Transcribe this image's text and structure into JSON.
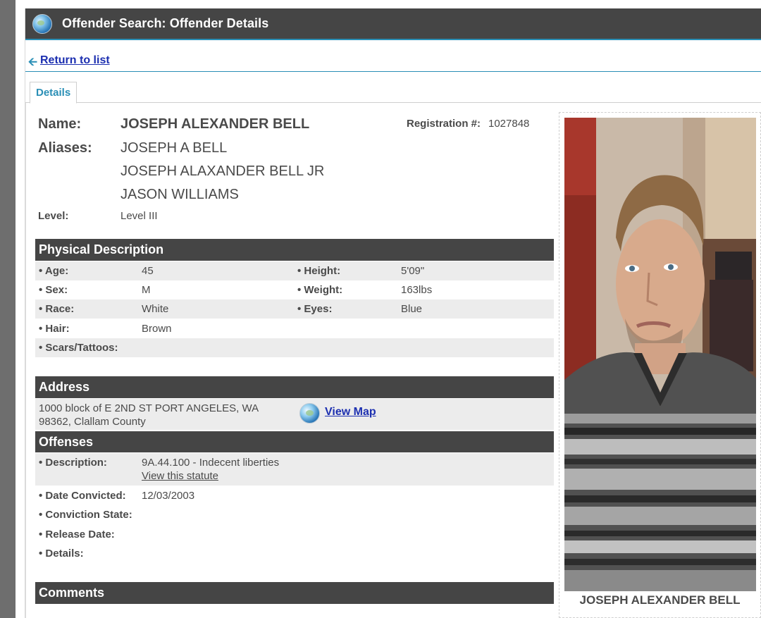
{
  "window": {
    "title": "Offender Search: Offender Details"
  },
  "nav": {
    "return_label": "Return to list"
  },
  "tabs": [
    {
      "label": "Details"
    }
  ],
  "offender": {
    "name_label": "Name:",
    "name": "JOSEPH ALEXANDER BELL",
    "aliases_label": "Aliases:",
    "aliases": [
      "JOSEPH A BELL",
      "JOSEPH ALAXANDER BELL JR",
      "JASON WILLIAMS"
    ],
    "registration_label": "Registration #:",
    "registration_number": "1027848",
    "level_label": "Level:",
    "level": "Level III"
  },
  "physical": {
    "title": "Physical Description",
    "rows": [
      {
        "label1": "• Age:",
        "value1": "45",
        "label2": "• Height:",
        "value2": "5'09\""
      },
      {
        "label1": "• Sex:",
        "value1": "M",
        "label2": "• Weight:",
        "value2": "163lbs"
      },
      {
        "label1": "• Race:",
        "value1": "White",
        "label2": "• Eyes:",
        "value2": "Blue"
      },
      {
        "label1": "• Hair:",
        "value1": "Brown",
        "label2": "",
        "value2": ""
      },
      {
        "label1": "• Scars/Tattoos:",
        "value1": "",
        "label2": "",
        "value2": ""
      }
    ]
  },
  "address": {
    "title": "Address",
    "line1": "1000 block of E 2ND ST PORT ANGELES, WA",
    "line2": "98362, Clallam County",
    "map_link": "View Map"
  },
  "offenses": {
    "title": "Offenses",
    "description_label": "• Description:",
    "description": "9A.44.100 - Indecent liberties",
    "statute_link": "View this statute",
    "date_convicted_label": "• Date Convicted:",
    "date_convicted": "12/03/2003",
    "conviction_state_label": "• Conviction State:",
    "release_date_label": "• Release Date:",
    "details_label": "• Details:"
  },
  "comments": {
    "title": "Comments"
  },
  "photo": {
    "caption": "JOSEPH ALEXANDER BELL"
  },
  "colors": {
    "header_bg": "#454545",
    "accent": "#2a8fb6",
    "link": "#1c2fb0",
    "row_shade": "#ececec"
  }
}
